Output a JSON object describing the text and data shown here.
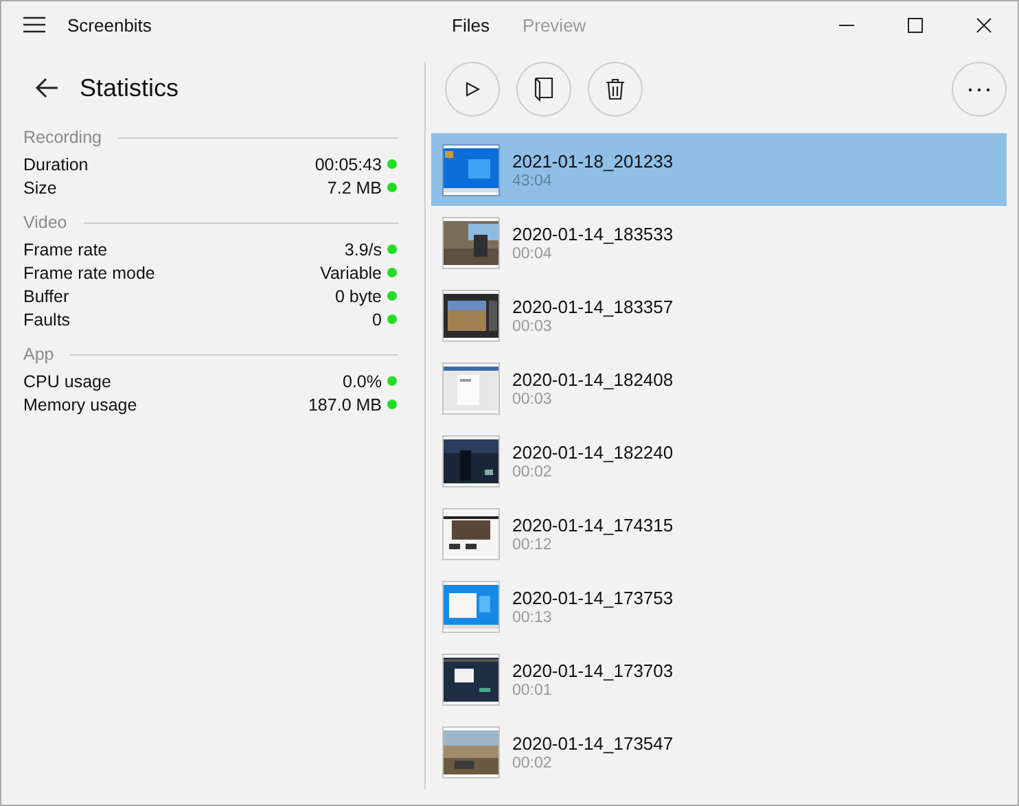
{
  "window": {
    "app_name": "Screenbits"
  },
  "tabs": [
    {
      "label": "Files",
      "selected": true
    },
    {
      "label": "Preview",
      "selected": false
    }
  ],
  "statistics": {
    "title": "Statistics",
    "sections": [
      {
        "title": "Recording",
        "rows": [
          {
            "label": "Duration",
            "value": "00:05:43",
            "ok": true
          },
          {
            "label": "Size",
            "value": "7.2 MB",
            "ok": true
          }
        ]
      },
      {
        "title": "Video",
        "rows": [
          {
            "label": "Frame rate",
            "value": "3.9/s",
            "ok": true
          },
          {
            "label": "Frame rate mode",
            "value": "Variable",
            "ok": true
          },
          {
            "label": "Buffer",
            "value": "0 byte",
            "ok": true
          },
          {
            "label": "Faults",
            "value": "0",
            "ok": true
          }
        ]
      },
      {
        "title": "App",
        "rows": [
          {
            "label": "CPU usage",
            "value": "0.0%",
            "ok": true
          },
          {
            "label": "Memory usage",
            "value": "187.0 MB",
            "ok": true
          }
        ]
      }
    ]
  },
  "files": [
    {
      "name": "2021-01-18_201233",
      "duration": "43:04",
      "selected": true
    },
    {
      "name": "2020-01-14_183533",
      "duration": "00:04",
      "selected": false
    },
    {
      "name": "2020-01-14_183357",
      "duration": "00:03",
      "selected": false
    },
    {
      "name": "2020-01-14_182408",
      "duration": "00:03",
      "selected": false
    },
    {
      "name": "2020-01-14_182240",
      "duration": "00:02",
      "selected": false
    },
    {
      "name": "2020-01-14_174315",
      "duration": "00:12",
      "selected": false
    },
    {
      "name": "2020-01-14_173753",
      "duration": "00:13",
      "selected": false
    },
    {
      "name": "2020-01-14_173703",
      "duration": "00:01",
      "selected": false
    },
    {
      "name": "2020-01-14_173547",
      "duration": "00:02",
      "selected": false
    }
  ]
}
